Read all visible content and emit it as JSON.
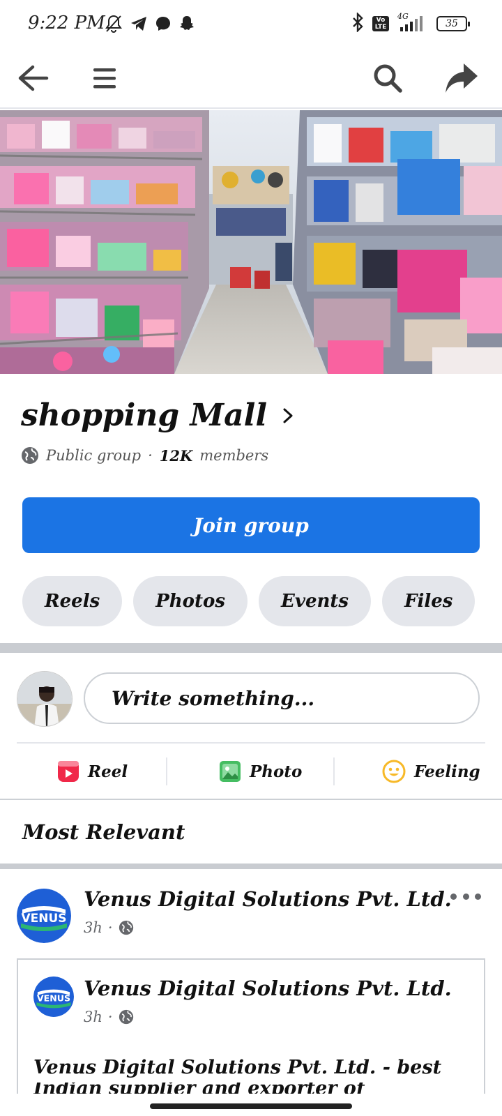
{
  "status_bar": {
    "time": "9:22 PM",
    "network": "4G",
    "volte": "Vo LTE",
    "battery": "35",
    "icons": [
      "bell-off-icon",
      "telegram-icon",
      "messenger-icon",
      "snapchat-icon",
      "bluetooth-icon",
      "signal-icon"
    ]
  },
  "toolbar": {
    "icons": [
      "back-arrow-icon",
      "hamburger-menu-icon",
      "search-icon",
      "share-icon"
    ]
  },
  "group": {
    "name": "shopping Mall",
    "privacy": "Public group",
    "separator": "·",
    "member_count": "12K",
    "members_label": "members",
    "join_label": "Join group"
  },
  "chips": [
    "Reels",
    "Photos",
    "Events",
    "Files"
  ],
  "composer": {
    "placeholder": "Write something...",
    "actions": {
      "reel": "Reel",
      "photo": "Photo",
      "feeling": "Feeling"
    }
  },
  "feed": {
    "sort_label": "Most Relevant"
  },
  "post": {
    "author": "Venus Digital Solutions Pvt. Ltd.",
    "time": "3h",
    "logo_text": "VENUS",
    "shared": {
      "author": "Venus Digital Solutions Pvt. Ltd.",
      "time": "3h",
      "text_line1": "Venus Digital Solutions Pvt. Ltd. - best",
      "text_line2": "Indian supplier and exporter of innovative digital"
    }
  },
  "colors": {
    "accent": "#1b74e4",
    "chip_bg": "#e4e6eb",
    "reel_icon": "#f02849",
    "photo_icon": "#45bd62",
    "feeling_icon": "#f7b928"
  }
}
